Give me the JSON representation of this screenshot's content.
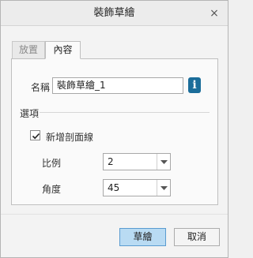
{
  "window": {
    "title": "裝飾草繪",
    "close_glyph": "×"
  },
  "tabs": [
    {
      "label": "放置",
      "active": false
    },
    {
      "label": "內容",
      "active": true
    }
  ],
  "name": {
    "label": "名稱",
    "value": "裝飾草繪_1",
    "info_glyph": "i"
  },
  "options": {
    "section_label": "選項",
    "add_hatching": {
      "label": "新增剖面線",
      "checked": true
    },
    "scale": {
      "label": "比例",
      "value": "2"
    },
    "angle": {
      "label": "角度",
      "value": "45"
    }
  },
  "buttons": {
    "ok": "草繪",
    "cancel": "取消"
  },
  "colors": {
    "info_icon": "#1b6d9a",
    "primary_button": "#b9dbf3",
    "primary_border": "#5a9bd0"
  }
}
